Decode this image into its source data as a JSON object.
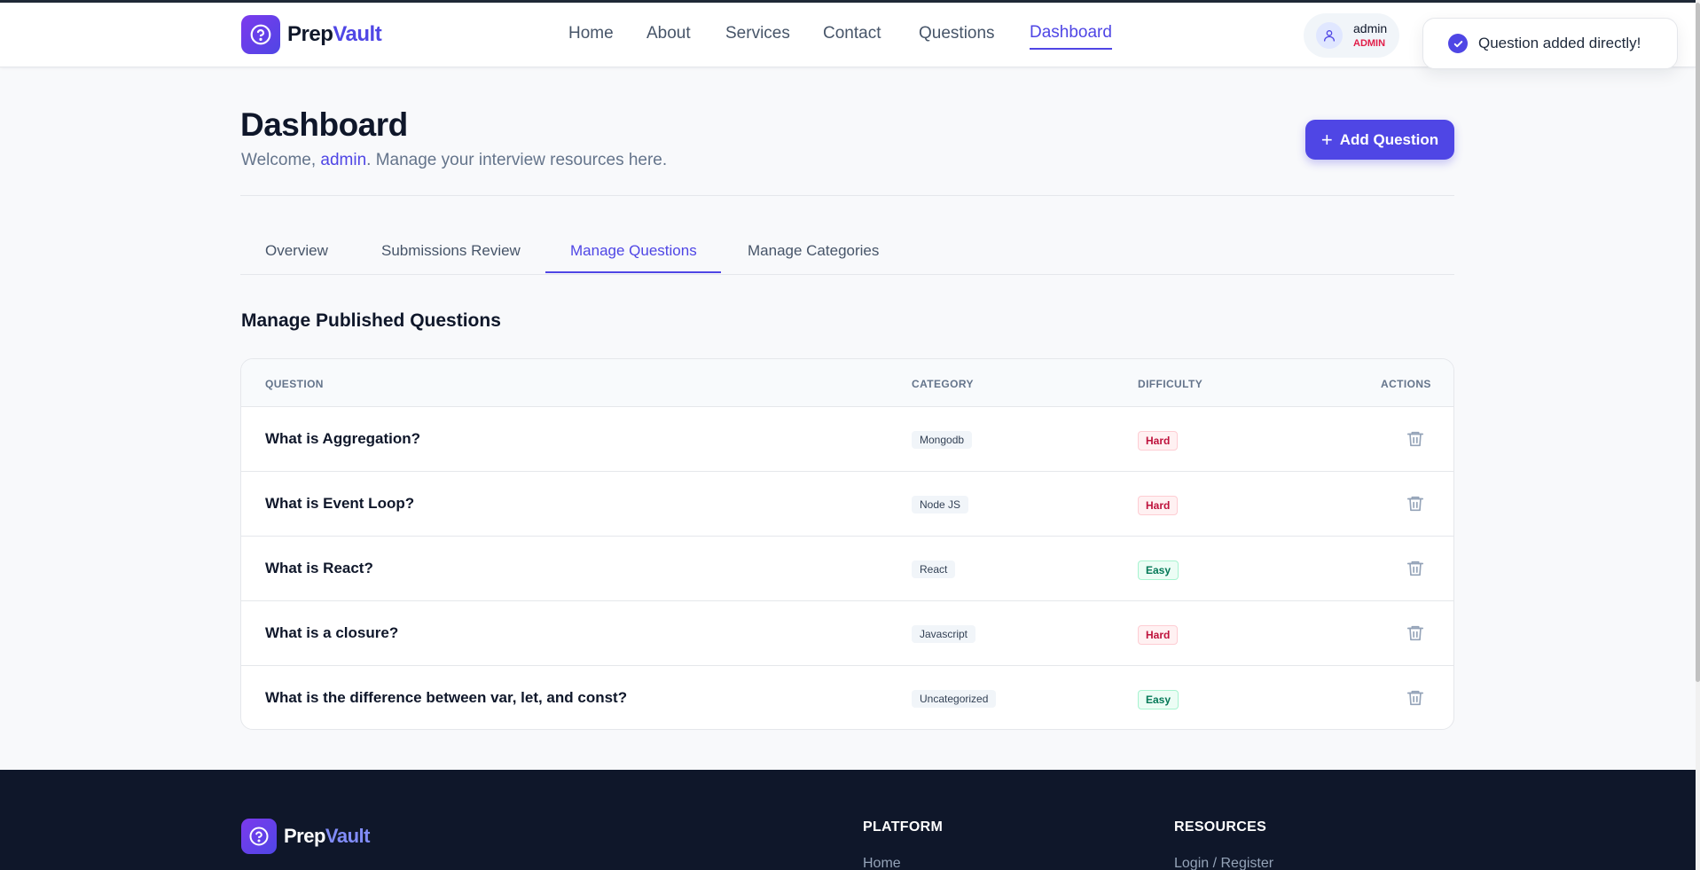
{
  "brand": {
    "part1": "Prep",
    "part2": "Vault"
  },
  "nav": {
    "items": [
      "Home",
      "About",
      "Services",
      "Contact",
      "Questions",
      "Dashboard"
    ],
    "active_index": 5
  },
  "user": {
    "name": "admin",
    "role": "ADMIN"
  },
  "toast": {
    "message": "Question added directly!"
  },
  "page": {
    "title": "Dashboard",
    "welcome_prefix": "Welcome, ",
    "welcome_user": "admin",
    "welcome_suffix": ". Manage your interview resources here.",
    "add_button_label": "Add Question"
  },
  "tabs": {
    "items": [
      "Overview",
      "Submissions Review",
      "Manage Questions",
      "Manage Categories"
    ],
    "active_index": 2
  },
  "section": {
    "title": "Manage Published Questions"
  },
  "table": {
    "columns": [
      "QUESTION",
      "CATEGORY",
      "DIFFICULTY",
      "ACTIONS"
    ],
    "rows": [
      {
        "question": "What is Aggregation?",
        "category": "Mongodb",
        "difficulty": "Hard"
      },
      {
        "question": "What is Event Loop?",
        "category": "Node JS",
        "difficulty": "Hard"
      },
      {
        "question": "What is React?",
        "category": "React",
        "difficulty": "Easy"
      },
      {
        "question": "What is a closure?",
        "category": "Javascript",
        "difficulty": "Hard"
      },
      {
        "question": "What is the difference between var, let, and const?",
        "category": "Uncategorized",
        "difficulty": "Easy"
      }
    ]
  },
  "footer": {
    "platform_heading": "PLATFORM",
    "platform_link": "Home",
    "resources_heading": "RESOURCES",
    "resources_link": "Login / Register"
  },
  "colors": {
    "accent": "#4f46e5",
    "hard": "#be123c",
    "easy": "#047857",
    "footer_bg": "#0f172a"
  }
}
